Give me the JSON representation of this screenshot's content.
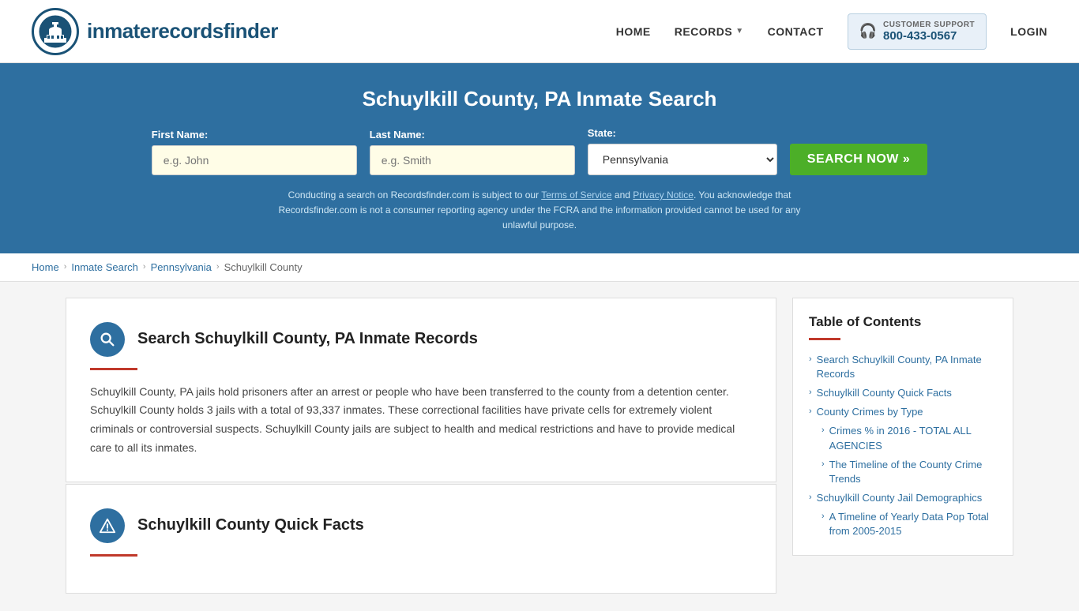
{
  "header": {
    "logo_text_light": "inmaterecords",
    "logo_text_bold": "finder",
    "nav": {
      "home": "HOME",
      "records": "RECORDS",
      "contact": "CONTACT",
      "login": "LOGIN"
    },
    "support": {
      "label": "CUSTOMER SUPPORT",
      "number": "800-433-0567"
    }
  },
  "hero": {
    "title": "Schuylkill County, PA Inmate Search",
    "form": {
      "first_name_label": "First Name:",
      "first_name_placeholder": "e.g. John",
      "last_name_label": "Last Name:",
      "last_name_placeholder": "e.g. Smith",
      "state_label": "State:",
      "state_value": "Pennsylvania",
      "search_button": "SEARCH NOW »"
    },
    "disclaimer": "Conducting a search on Recordsfinder.com is subject to our Terms of Service and Privacy Notice. You acknowledge that Recordsfinder.com is not a consumer reporting agency under the FCRA and the information provided cannot be used for any unlawful purpose."
  },
  "breadcrumb": {
    "items": [
      "Home",
      "Inmate Search",
      "Pennsylvania",
      "Schuylkill County"
    ]
  },
  "sections": [
    {
      "id": "search",
      "icon_type": "search",
      "title": "Search Schuylkill County, PA Inmate Records",
      "text": "Schuylkill County, PA jails hold prisoners after an arrest or people who have been transferred to the county from a detention center. Schuylkill County holds 3 jails with a total of 93,337 inmates. These correctional facilities have private cells for extremely violent criminals or controversial suspects. Schuylkill County jails are subject to health and medical restrictions and have to provide medical care to all its inmates."
    },
    {
      "id": "quick-facts",
      "icon_type": "info",
      "title": "Schuylkill County Quick Facts",
      "text": ""
    }
  ],
  "toc": {
    "title": "Table of Contents",
    "items": [
      {
        "label": "Search Schuylkill County, PA Inmate Records",
        "sub": false
      },
      {
        "label": "Schuylkill County Quick Facts",
        "sub": false
      },
      {
        "label": "County Crimes by Type",
        "sub": false
      },
      {
        "label": "Crimes % in 2016 - TOTAL ALL AGENCIES",
        "sub": true
      },
      {
        "label": "The Timeline of the County Crime Trends",
        "sub": true
      },
      {
        "label": "Schuylkill County Jail Demographics",
        "sub": false
      },
      {
        "label": "A Timeline of Yearly Data Pop Total from 2005-2015",
        "sub": true
      }
    ]
  }
}
